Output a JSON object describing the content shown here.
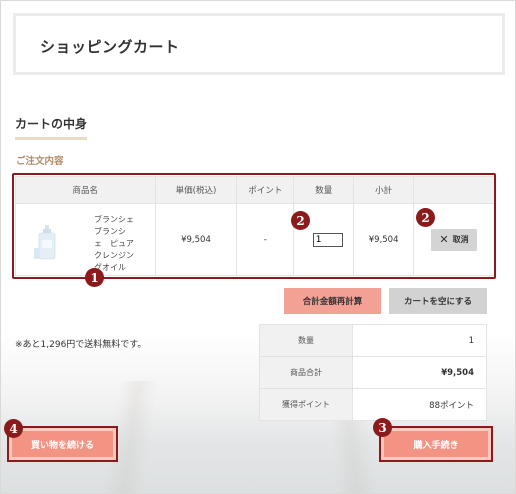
{
  "page": {
    "title": "ショッピングカート"
  },
  "cart": {
    "section_title": "カートの中身",
    "order_label": "ご注文内容",
    "headers": {
      "product": "商品名",
      "unit_price": "単価(税込)",
      "point": "ポイント",
      "quantity": "数量",
      "subtotal": "小計"
    },
    "item": {
      "image_icon": "product-bottle-icon",
      "name": "ブランシェ ブランシェ ピュア クレンジングオイル",
      "name_lines": [
        "ブランシェ",
        "ブランシ",
        "ェ　ピュア",
        "クレンジン",
        "グオイル"
      ],
      "unit_price": "¥9,504",
      "point": "-",
      "quantity": "1",
      "subtotal": "¥9,504",
      "cancel_label": "取消",
      "cancel_icon": "close-icon"
    }
  },
  "buttons": {
    "recalc": "合計金額再計算",
    "empty_cart": "カートを空にする",
    "continue_shopping": "買い物を続ける",
    "checkout": "購入手続き"
  },
  "shipping_note": "※あと1,296円で送料無料です。",
  "summary": {
    "quantity_label": "数量",
    "quantity_value": "1",
    "total_label": "商品合計",
    "total_value": "¥9,504",
    "points_label": "獲得ポイント",
    "points_value": "88ポイント"
  },
  "markers": {
    "m1": "1",
    "m2a": "2",
    "m2b": "2",
    "m3": "3",
    "m4": "4"
  },
  "colors": {
    "annotation": "#8b1a1a",
    "primary_button": "#f29384",
    "secondary_button": "#d2d2d2",
    "accent_label": "#b08a6a"
  }
}
